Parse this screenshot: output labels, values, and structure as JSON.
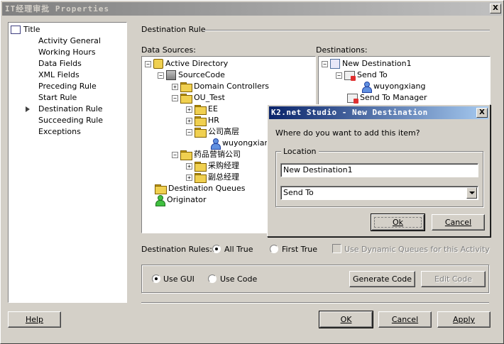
{
  "window": {
    "title": "IT经理审批 Properties",
    "close_label": "X"
  },
  "nav": {
    "root_label": "Title",
    "items": [
      {
        "label": "Activity General"
      },
      {
        "label": "Working Hours"
      },
      {
        "label": "Data  Fields"
      },
      {
        "label": "XML Fields"
      },
      {
        "label": "Preceding Rule"
      },
      {
        "label": "Start Rule"
      },
      {
        "label": "Destination Rule"
      },
      {
        "label": "Succeeding Rule"
      },
      {
        "label": "Exceptions"
      }
    ],
    "selected": "Destination Rule"
  },
  "main": {
    "section_title": "Destination Rule",
    "data_sources_label": "Data Sources:",
    "destinations_label": "Destinations:"
  },
  "data_sources_tree": {
    "active_directory": "Active Directory",
    "source_code": "SourceCode",
    "domain_controllers": "Domain Controllers",
    "ou_test": "OU_Test",
    "ee": "EE",
    "hr": "HR",
    "company_top": "公司高层",
    "user_wuyong": "wuyongxiang",
    "pharma_sales": "药品营销公司",
    "purchase_mgr": "采购经理",
    "deputy_gm": "副总经理",
    "destination_queues": "Destination Queues",
    "originator": "Originator"
  },
  "destinations_tree": {
    "new_destination": "New Destination1",
    "send_to": "Send To",
    "user": "wuyongxiang",
    "send_to_manager": "Send To Manager"
  },
  "rules": {
    "label": "Destination Rules:",
    "all_true": "All True",
    "first_true": "First True",
    "dynamic_queues": "Use Dynamic Queues for this Activity",
    "selected": "All True"
  },
  "mode": {
    "use_gui": "Use GUI",
    "use_code": "Use Code",
    "generate_code": "Generate Code",
    "edit_code": "Edit Code",
    "selected": "Use GUI"
  },
  "footer": {
    "help": "Help",
    "ok": "OK",
    "cancel": "Cancel",
    "apply": "Apply"
  },
  "dialog": {
    "title": "K2.net Studio - New Destination",
    "question": "Where do you want to add this item?",
    "group_label": "Location",
    "text_value": "New Destination1",
    "select_value": "Send To",
    "ok": "Ok",
    "cancel": "Cancel",
    "close_label": "X"
  }
}
